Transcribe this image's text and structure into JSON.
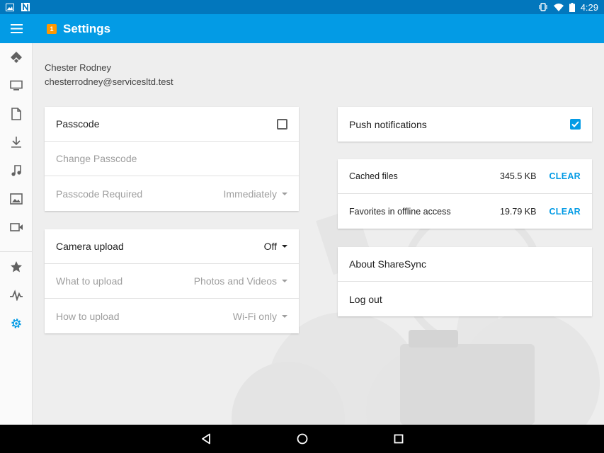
{
  "status_bar": {
    "time": "4:29",
    "icons": [
      "image-icon",
      "n-icon",
      "vibrate-icon",
      "wifi-icon",
      "battery-icon"
    ]
  },
  "app_bar": {
    "badge": "1",
    "title": "Settings",
    "accent": "#039be5"
  },
  "rail": {
    "items": [
      "sharesync-icon",
      "monitor-icon",
      "document-icon",
      "download-icon",
      "music-icon",
      "image-icon",
      "video-icon",
      "star-icon",
      "activity-icon",
      "gear-icon"
    ],
    "active": "gear-icon"
  },
  "user": {
    "name": "Chester Rodney",
    "email": "chesterrodney@servicesltd.test"
  },
  "passcode_card": {
    "passcode_label": "Passcode",
    "passcode_checked": false,
    "change_label": "Change Passcode",
    "required_label": "Passcode Required",
    "required_value": "Immediately"
  },
  "camera_card": {
    "upload_label": "Camera upload",
    "upload_value": "Off",
    "what_label": "What to upload",
    "what_value": "Photos and Videos",
    "how_label": "How to upload",
    "how_value": "Wi-Fi only"
  },
  "push_card": {
    "label": "Push notifications",
    "checked": true
  },
  "storage_card": {
    "cached_label": "Cached files",
    "cached_size": "345.5 KB",
    "cached_action": "CLEAR",
    "offline_label": "Favorites in offline access",
    "offline_size": "19.79 KB",
    "offline_action": "CLEAR"
  },
  "about_card": {
    "about_label": "About ShareSync",
    "logout_label": "Log out"
  },
  "nav_bar": {
    "buttons": [
      "back-icon",
      "home-icon",
      "recents-icon"
    ]
  }
}
